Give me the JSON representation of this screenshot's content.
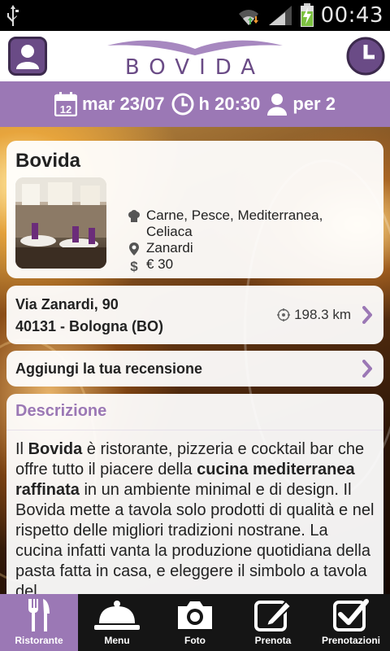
{
  "status_bar": {
    "time": "00:43"
  },
  "header": {
    "logo_text": "BOVIDA"
  },
  "booking": {
    "date": "mar 23/07",
    "calendar_day": "12",
    "time": "h 20:30",
    "people": "per 2"
  },
  "restaurant": {
    "name": "Bovida",
    "cuisine": "Carne, Pesce, Mediterranea, Celiaca",
    "area": "Zanardi",
    "price": "€ 30"
  },
  "address": {
    "street": "Via Zanardi, 90",
    "city": "40131 - Bologna (BO)",
    "distance": "198.3 km"
  },
  "review": {
    "label": "Aggiungi la tua recensione"
  },
  "description": {
    "title": "Descrizione",
    "p1": "Il ",
    "b1": "Bovida",
    "p2": " è ristorante, pizzeria e cocktail bar che offre tutto il piacere della ",
    "b2": "cucina mediterranea raffinata",
    "p3": " in un ambiente minimal e di design. Il Bovida mette a tavola solo prodotti di qualità e nel rispetto delle migliori tradizioni nostrane. La cucina infatti vanta la produzione quotidiana della pasta fatta in casa, e eleggere il simbolo a tavola del"
  },
  "tabs": [
    {
      "label": "Ristorante",
      "icon": "cutlery-icon"
    },
    {
      "label": "Menu",
      "icon": "cloche-icon"
    },
    {
      "label": "Foto",
      "icon": "camera-icon"
    },
    {
      "label": "Prenota",
      "icon": "pencil-icon"
    },
    {
      "label": "Prenotazioni",
      "icon": "checkbox-icon"
    }
  ],
  "colors": {
    "accent": "#9b78b5",
    "dark": "#151515",
    "header_icon": "#6a4b86"
  }
}
